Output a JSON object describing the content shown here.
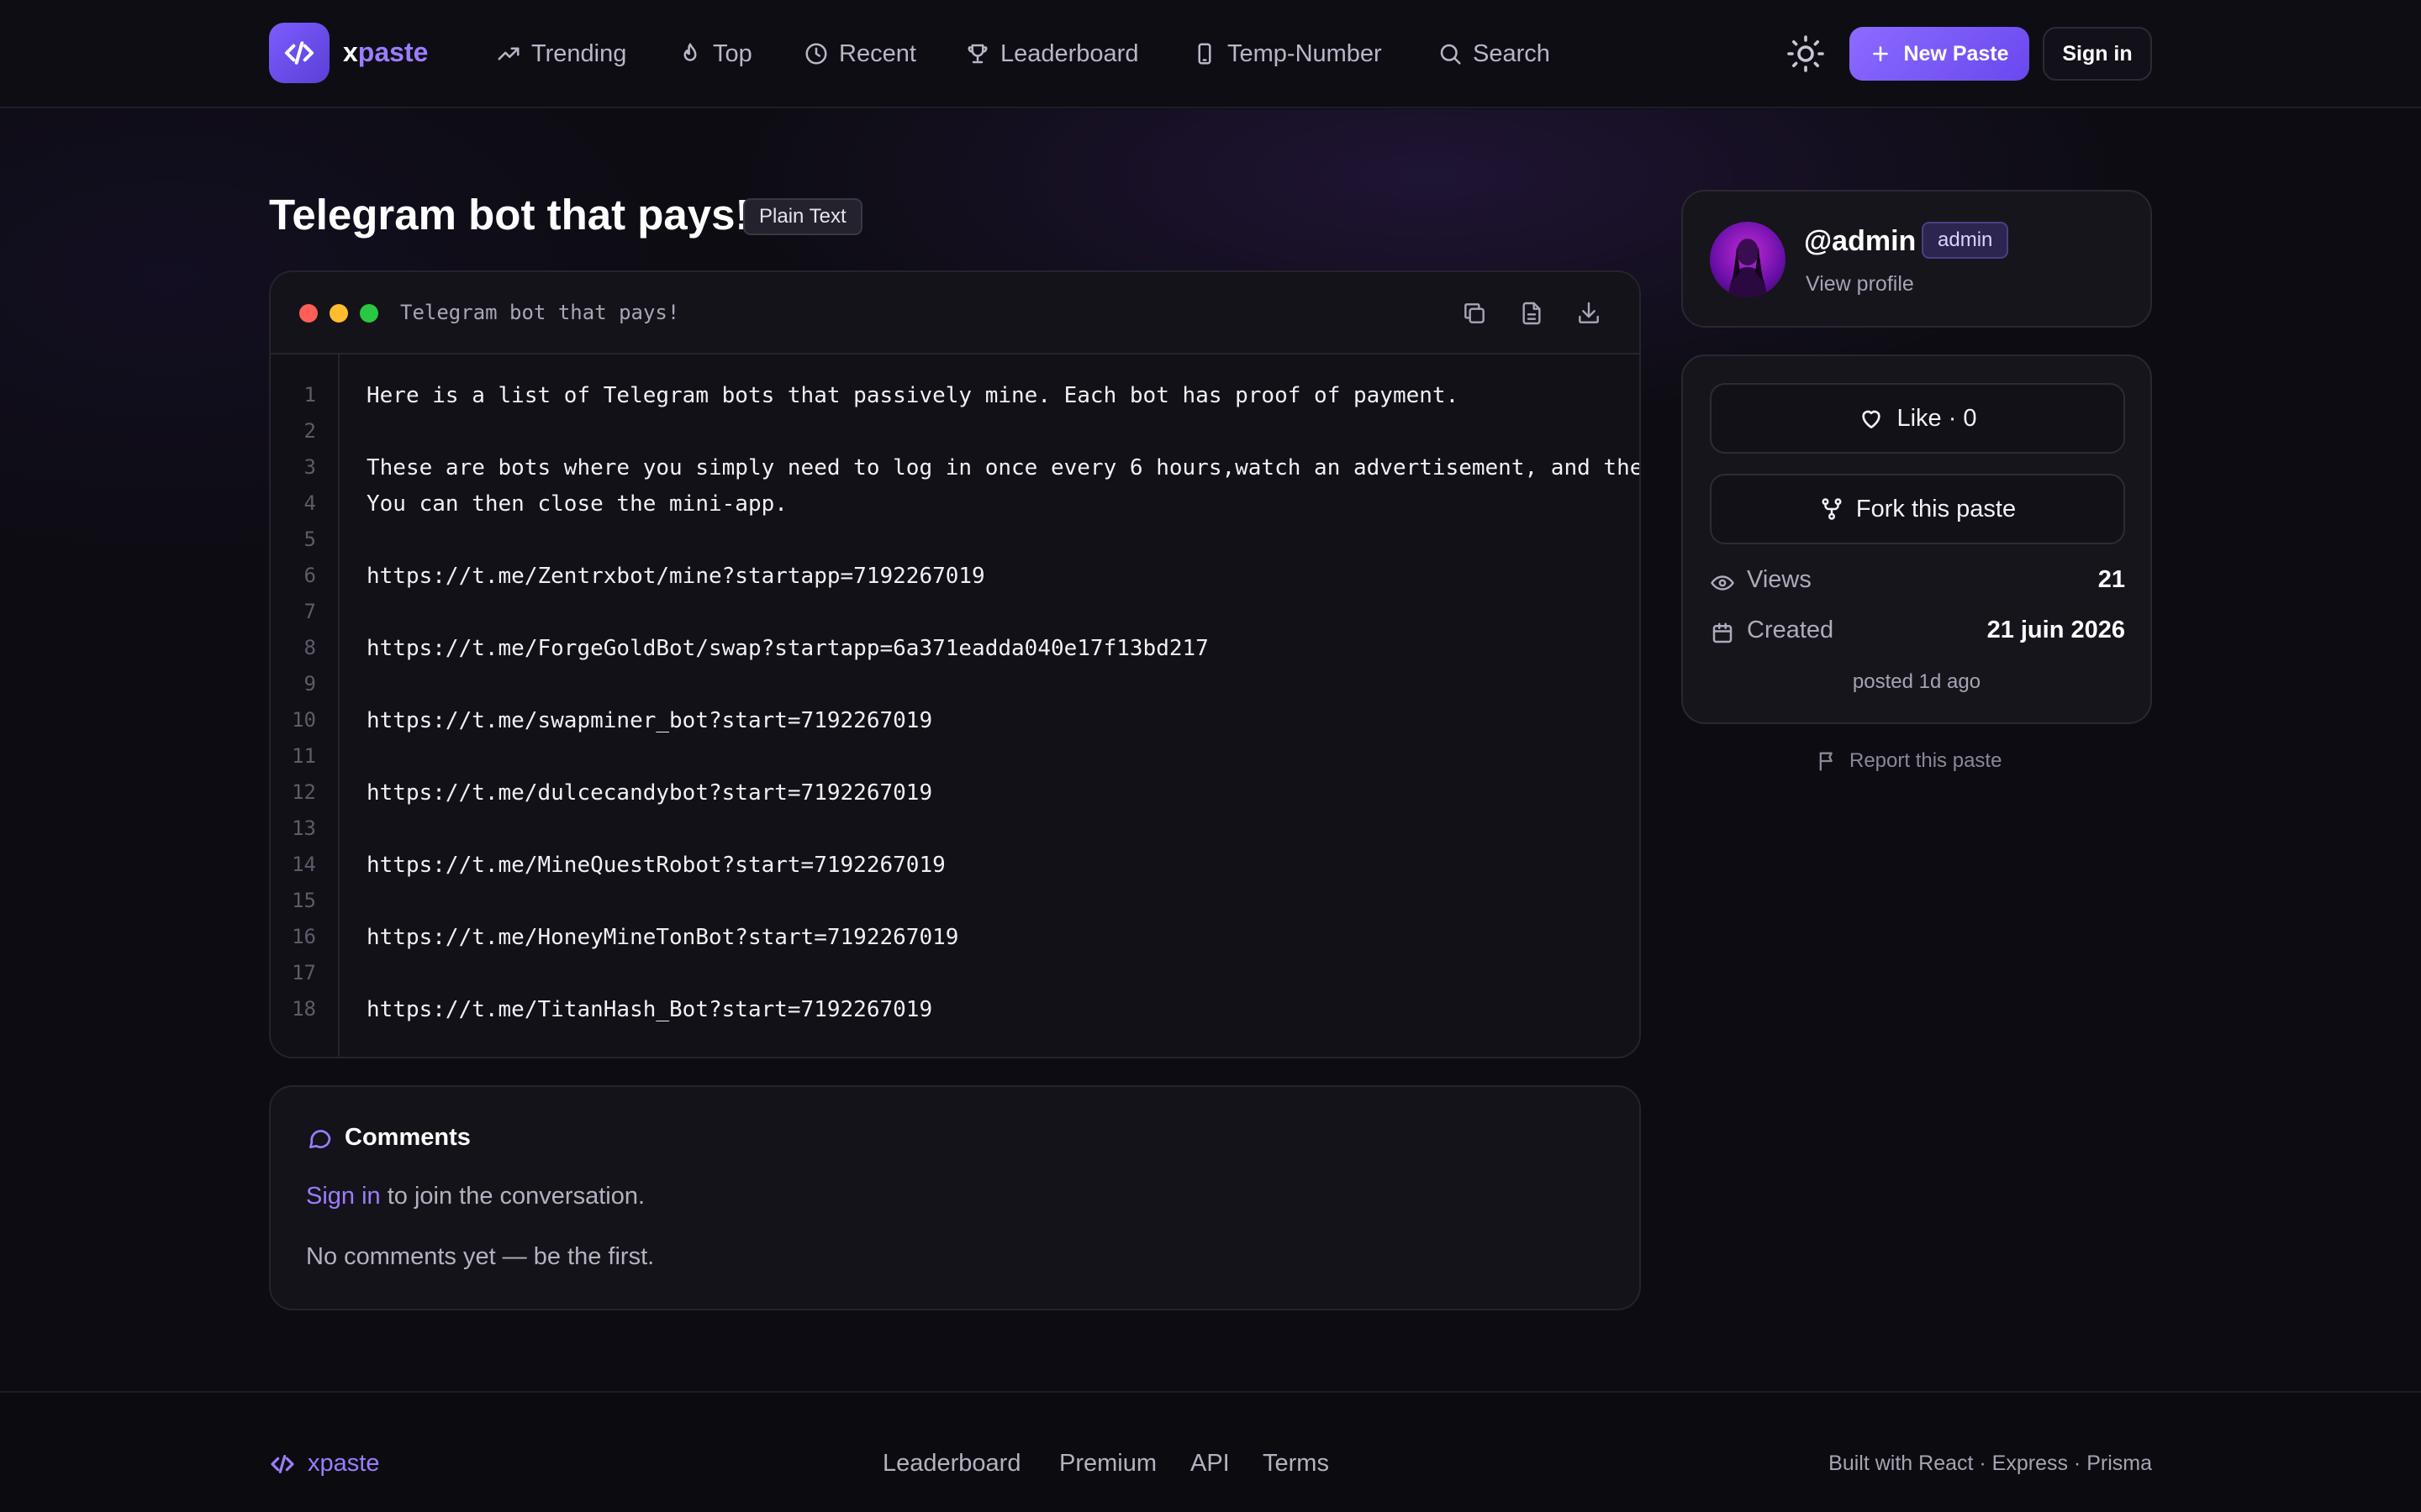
{
  "brand": {
    "name_x": "x",
    "name_rest": "paste"
  },
  "nav": {
    "items": [
      {
        "label": "Trending",
        "icon": "trending-icon"
      },
      {
        "label": "Top",
        "icon": "flame-icon"
      },
      {
        "label": "Recent",
        "icon": "clock-icon"
      },
      {
        "label": "Leaderboard",
        "icon": "trophy-icon"
      },
      {
        "label": "Temp-Number",
        "icon": "phone-icon"
      },
      {
        "label": "Search",
        "icon": "search-icon"
      }
    ],
    "new_paste_label": "New Paste",
    "signin_label": "Sign in"
  },
  "paste": {
    "title": "Telegram bot that pays!",
    "language": "Plain Text",
    "file_name": "Telegram bot that pays!",
    "lines": [
      "Here is a list of Telegram bots that passively mine. Each bot has proof of payment.",
      "",
      "These are bots where you simply need to log in once every 6 hours,watch an advertisement, and the",
      "You can then close the mini-app.",
      "",
      "https://t.me/Zentrxbot/mine?startapp=7192267019",
      "",
      "https://t.me/ForgeGoldBot/swap?startapp=6a371eadda040e17f13bd217",
      "",
      "https://t.me/swapminer_bot?start=7192267019",
      "",
      "https://t.me/dulcecandybot?start=7192267019",
      "",
      "https://t.me/MineQuestRobot?start=7192267019",
      "",
      "https://t.me/HoneyMineTonBot?start=7192267019",
      "",
      "https://t.me/TitanHash_Bot?start=7192267019"
    ]
  },
  "comments": {
    "title": "Comments",
    "signin_link": "Sign in",
    "signin_rest": " to join the conversation.",
    "empty": "No comments yet — be the first."
  },
  "author": {
    "username": "@admin",
    "badge": "admin",
    "view_profile": "View profile"
  },
  "stats": {
    "like_label": "Like · 0",
    "fork_label": "Fork this paste",
    "views_label": "Views",
    "views_value": "21",
    "created_label": "Created",
    "created_value": "21 juin 2026",
    "posted": "posted 1d ago"
  },
  "report_label": "Report this paste",
  "footer": {
    "brand": "xpaste",
    "links": [
      "Leaderboard",
      "Premium",
      "API",
      "Terms"
    ],
    "built": "Built with React · Express · Prisma"
  },
  "colors": {
    "accent": "#8b6bff",
    "dot_red": "#ff5f57",
    "dot_yellow": "#febc2e",
    "dot_green": "#28c840"
  }
}
